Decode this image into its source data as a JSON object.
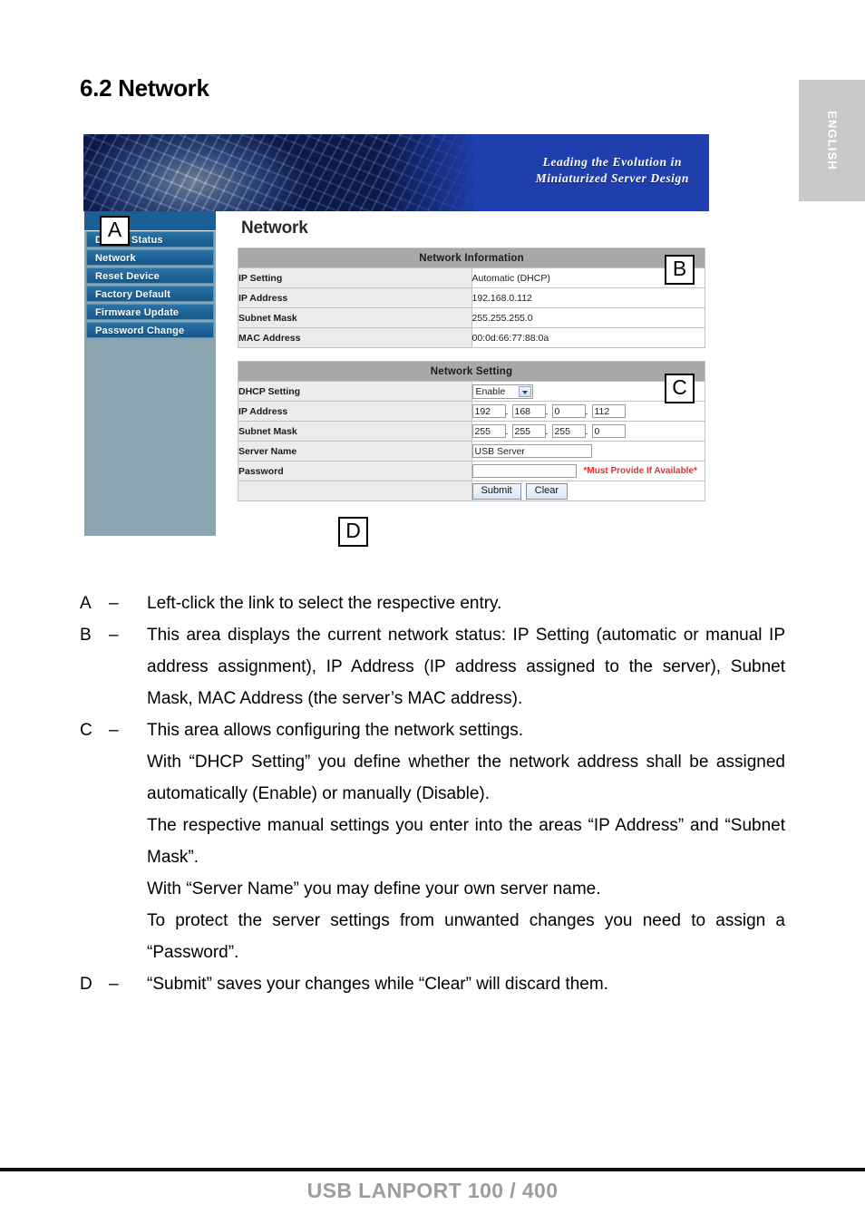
{
  "language_tab": {
    "label": "ENGLISH"
  },
  "section": {
    "heading": "6.2 Network"
  },
  "screenshot": {
    "banner": {
      "tagline_line1": "Leading the Evolution in",
      "tagline_line2": "Miniaturized Server Design"
    },
    "sidebar": {
      "items": [
        {
          "label": "Device Status"
        },
        {
          "label": "Network"
        },
        {
          "label": "Reset Device"
        },
        {
          "label": "Factory Default"
        },
        {
          "label": "Firmware Update"
        },
        {
          "label": "Password Change"
        }
      ]
    },
    "page_title": "Network",
    "network_information": {
      "header": "Network Information",
      "rows": [
        {
          "label": "IP Setting",
          "value": "Automatic (DHCP)"
        },
        {
          "label": "IP Address",
          "value": "192.168.0.112"
        },
        {
          "label": "Subnet Mask",
          "value": "255.255.255.0"
        },
        {
          "label": "MAC Address",
          "value": "00:0d:66:77:88:0a"
        }
      ]
    },
    "network_setting": {
      "header": "Network Setting",
      "dhcp_label": "DHCP Setting",
      "dhcp_value": "Enable",
      "ip_label": "IP Address",
      "ip_octets": [
        "192",
        "168",
        "0",
        "112"
      ],
      "mask_label": "Subnet Mask",
      "mask_octets": [
        "255",
        "255",
        "255",
        "0"
      ],
      "server_name_label": "Server Name",
      "server_name_value": "USB Server",
      "password_label": "Password",
      "password_value": "",
      "password_hint": "*Must Provide If Available*",
      "submit_label": "Submit",
      "clear_label": "Clear"
    },
    "markers": {
      "a": "A",
      "b": "B",
      "c": "C",
      "d": "D"
    }
  },
  "legend": {
    "items": [
      {
        "letter": "A",
        "dash": "–",
        "paragraphs": [
          "Left-click the link to select the respective entry."
        ]
      },
      {
        "letter": "B",
        "dash": "–",
        "paragraphs": [
          "This area displays the current network status: IP Setting (automatic or manual IP address assignment), IP Address (IP address assigned to the server), Subnet Mask, MAC Address (the server’s MAC address)."
        ]
      },
      {
        "letter": "C",
        "dash": "–",
        "paragraphs": [
          "This area allows configuring the network settings.",
          "With “DHCP Setting” you define whether the network address shall be assigned automatically (Enable) or manually (Disable).",
          "The respective manual settings you enter into the areas “IP Address” and “Subnet Mask”.",
          "With “Server Name” you may define your own server name.",
          "To protect the server settings from unwanted changes you need to assign a “Password”."
        ]
      },
      {
        "letter": "D",
        "dash": "–",
        "paragraphs": [
          "“Submit” saves your changes while “Clear” will discard them."
        ]
      }
    ]
  },
  "footer": {
    "title": "USB LANPORT 100 / 400"
  }
}
